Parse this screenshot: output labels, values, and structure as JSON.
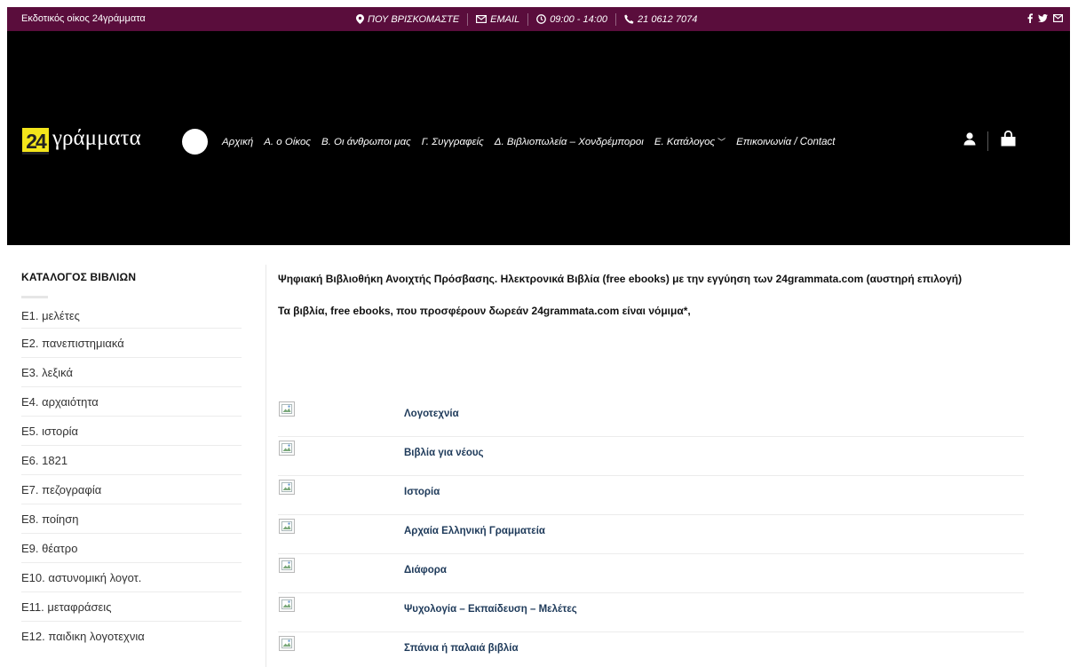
{
  "topbar": {
    "company": "Εκδοτικός οίκος 24γράμματα",
    "location": "ΠΟΥ ΒΡΙΣΚΟΜΑΣΤΕ",
    "email": "EMAIL",
    "hours": "09:00 - 14:00",
    "phone": "21 0612 7074",
    "social": [
      "facebook-icon",
      "twitter-icon",
      "envelope-icon"
    ]
  },
  "header": {
    "logo_number": "24",
    "logo_text": "γράμματα",
    "nav": [
      {
        "label": "Αρχική"
      },
      {
        "label": "Α. ο Οίκος"
      },
      {
        "label": "Β. Οι άνθρωποι μας"
      },
      {
        "label": "Γ. Συγγραφείς"
      },
      {
        "label": "Δ. Βιβλιοπωλεία – Χονδρέμποροι"
      },
      {
        "label": "Ε. Κατάλογος",
        "has_dropdown": true
      },
      {
        "label": "Επικοινωνία / Contact"
      }
    ],
    "icons": [
      "user-icon",
      "cart-icon"
    ]
  },
  "sidebar": {
    "title": "ΚΑΤΑΛΟΓΟΣ ΒΙΒΛΙΩΝ",
    "items": [
      "Ε1. μελέτες",
      "Ε2. πανεπιστημιακά",
      "Ε3. λεξικά",
      "Ε4. αρχαιότητα",
      "Ε5. ιστορία",
      "Ε6. 1821",
      "Ε7. πεζογραφία",
      "Ε8. ποίηση",
      "Ε9. θέατρο",
      "Ε10. αστυνομική λογοτ.",
      "Ε11. μεταφράσεις",
      "Ε12. παιδικη λογοτεχνια"
    ]
  },
  "main": {
    "intro": "Ψηφιακή Βιβλιοθήκη Ανοιχτής Πρόσβασης. Ηλεκτρονικά Βιβλία (free ebooks) με την εγγύηση των 24grammata.com (αυστηρή επιλογή)",
    "note": "Τα βιβλία, free ebooks, που προσφέρουν δωρεάν 24grammata.com είναι νόμιμα*,",
    "categories": [
      "Λογοτεχνία",
      "Βιβλία για νέους",
      "Ιστορία",
      "Αρχαία Ελληνική Γραμματεία",
      "Διάφορα",
      "Ψυχολογία – Εκπαίδευση – Μελέτες",
      "Σπάνια ή παλαιά βιβλία"
    ]
  },
  "colors": {
    "topbar_bg": "#5a0d3c",
    "header_bg": "#000000",
    "logo_yellow": "#f3e51b",
    "category_link": "#1e3a5a"
  }
}
